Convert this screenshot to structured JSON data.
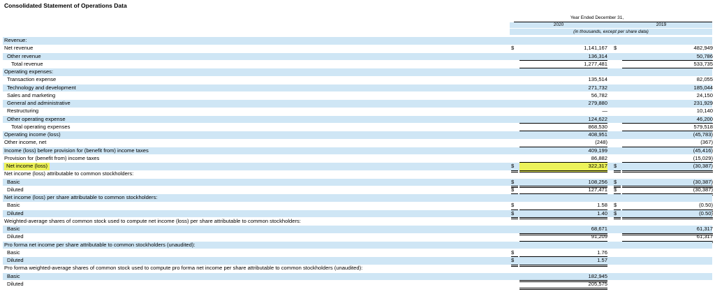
{
  "title": "Consolidated Statement of Operations Data",
  "header": {
    "period": "Year Ended December 31,",
    "year_2020": "2020",
    "year_2019": "2019",
    "note": "(in thousands, except per share data)"
  },
  "rows": [
    {
      "label": "Revenue:",
      "indent": 0,
      "shade": true
    },
    {
      "label": "Net revenue",
      "indent": 0,
      "shade": false,
      "d1": "$",
      "v1": "1,141,167",
      "d2": "$",
      "v2": "482,949"
    },
    {
      "label": "Other revenue",
      "indent": 1,
      "shade": true,
      "v1": "136,314",
      "v2": "50,786",
      "ul": true
    },
    {
      "label": "Total revenue",
      "indent": 2,
      "shade": false,
      "v1": "1,277,481",
      "v2": "533,735",
      "ul": true
    },
    {
      "label": "Operating expenses:",
      "indent": 0,
      "shade": true
    },
    {
      "label": "Transaction expense",
      "indent": 1,
      "shade": false,
      "v1": "135,514",
      "v2": "82,055"
    },
    {
      "label": "Technology and development",
      "indent": 1,
      "shade": true,
      "v1": "271,732",
      "v2": "185,044"
    },
    {
      "label": "Sales and marketing",
      "indent": 1,
      "shade": false,
      "v1": "56,782",
      "v2": "24,150"
    },
    {
      "label": "General and administrative",
      "indent": 1,
      "shade": true,
      "v1": "279,880",
      "v2": "231,929"
    },
    {
      "label": "Restructuring",
      "indent": 1,
      "shade": false,
      "v1": "—",
      "v2": "10,140"
    },
    {
      "label": "Other operating expense",
      "indent": 1,
      "shade": true,
      "v1": "124,622",
      "v2": "46,200",
      "ul": true
    },
    {
      "label": "Total operating expenses",
      "indent": 2,
      "shade": false,
      "v1": "868,530",
      "v2": "579,518",
      "ul": true
    },
    {
      "label": "Operating income (loss)",
      "indent": 0,
      "shade": true,
      "v1": "408,951",
      "v2": "(45,783)"
    },
    {
      "label": "Other income, net",
      "indent": 0,
      "shade": false,
      "v1": "(248)",
      "v2": "(367)",
      "ul": true
    },
    {
      "label": "Income (loss) before provision for (benefit from) income taxes",
      "indent": 0,
      "shade": true,
      "v1": "409,199",
      "v2": "(45,416)"
    },
    {
      "label": "Provision for (benefit from) income taxes",
      "indent": 0,
      "shade": false,
      "v1": "86,882",
      "v2": "(15,029)",
      "ul": true
    },
    {
      "label": "Net income (loss)",
      "indent": 0,
      "shade": true,
      "d1": "$",
      "v1": "322,317",
      "d2": "$",
      "v2": "(30,387)",
      "dbl": true,
      "highlight": true
    },
    {
      "label": "Net income (loss) attributable to common stockholders:",
      "indent": 0,
      "shade": false
    },
    {
      "label": "Basic",
      "indent": 1,
      "shade": true,
      "d1": "$",
      "v1": "108,256",
      "d2": "$",
      "v2": "(30,387)",
      "dbl": true
    },
    {
      "label": "Diluted",
      "indent": 1,
      "shade": false,
      "d1": "$",
      "v1": "127,471",
      "d2": "$",
      "v2": "(30,387)",
      "dbl": true
    },
    {
      "label": "Net income (loss) per share attributable to common stockholders:",
      "indent": 0,
      "shade": true
    },
    {
      "label": "Basic",
      "indent": 1,
      "shade": false,
      "d1": "$",
      "v1": "1.58",
      "d2": "$",
      "v2": "(0.50)",
      "dbl": true
    },
    {
      "label": "Diluted",
      "indent": 1,
      "shade": true,
      "d1": "$",
      "v1": "1.40",
      "d2": "$",
      "v2": "(0.50)",
      "dbl": true
    },
    {
      "label": "Weighted-average shares of common stock used to compute net income (loss) per share attributable to common stockholders:",
      "indent": 0,
      "shade": false
    },
    {
      "label": "Basic",
      "indent": 1,
      "shade": true,
      "v1": "68,671",
      "v2": "61,317",
      "dbl": true
    },
    {
      "label": "Diluted",
      "indent": 1,
      "shade": false,
      "v1": "91,209",
      "v2": "61,317",
      "dbl": true
    },
    {
      "label": "Pro forma net income per share attributable to common stockholders (unaudited):",
      "indent": 0,
      "shade": true
    },
    {
      "label": "Basic",
      "indent": 1,
      "shade": false,
      "d1": "$",
      "v1": "1.76",
      "dbl": true
    },
    {
      "label": "Diluted",
      "indent": 1,
      "shade": true,
      "d1": "$",
      "v1": "1.57",
      "dbl": true
    },
    {
      "label": "Pro forma weighted-average shares of common stock used to compute pro forma net income per share attributable to common stockholders (unaudited):",
      "indent": 0,
      "shade": false
    },
    {
      "label": "Basic",
      "indent": 1,
      "shade": true,
      "v1": "182,945",
      "dbl": true
    },
    {
      "label": "Diluted",
      "indent": 1,
      "shade": false,
      "v1": "205,575",
      "dbl": true
    }
  ],
  "colors": {
    "shade": "#cfe6f5",
    "highlight": "#ecf25a"
  }
}
